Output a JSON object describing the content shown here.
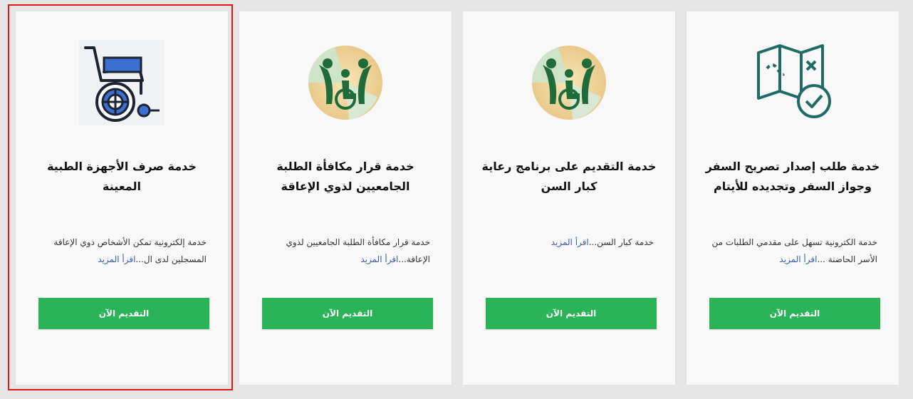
{
  "cards": [
    {
      "title": "خدمة طلب إصدار تصريح السفر وجواز السفر وتجديده للأيتام",
      "description": "خدمة الكترونية تسهل على مقدمي الطلبات من الأسر الحاضنة ...",
      "read_more": "اقرأ المزيد",
      "button_label": "التقديم الآن",
      "icon": "map-check-icon"
    },
    {
      "title": "خدمة التقديم على برنامج رعاية كبار السن",
      "description": "خدمة كبار السن...",
      "read_more": "اقرأ المزيد",
      "button_label": "التقديم الآن",
      "icon": "disability-people-icon"
    },
    {
      "title": "خدمة قرار مكافأة الطلبة الجامعيين لذوي الإعاقة",
      "description": "خدمة قرار مكافأة الطلبة الجامعيين لذوي الإعاقة...",
      "read_more": "اقرأ المزيد",
      "button_label": "التقديم الآن",
      "icon": "disability-people-icon"
    },
    {
      "title": "خدمة صرف الأجهزة الطبية المعينة",
      "description": "خدمة إلكترونية تمكن الأشخاص ذوي الإعاقة المسجلين لدى ال...",
      "read_more": "اقرأ المزيد",
      "button_label": "التقديم الآن",
      "icon": "wheelchair-icon"
    }
  ],
  "colors": {
    "button": "#2bb357",
    "highlight": "#e01818",
    "link": "#3b5ea0",
    "card_bg": "#f8f8f8",
    "page_bg": "#e6e6e6"
  }
}
